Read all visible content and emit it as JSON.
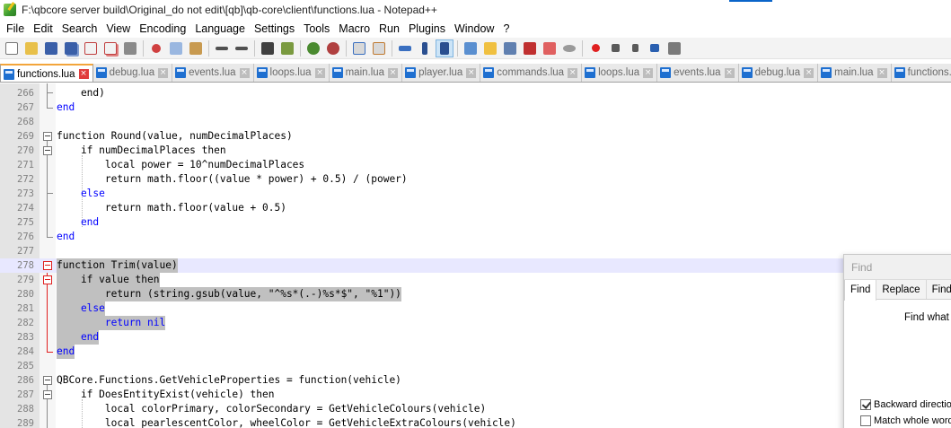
{
  "window": {
    "title": "F:\\qbcore server build\\Original_do not edit\\[qb]\\qb-core\\client\\functions.lua - Notepad++"
  },
  "menu": [
    "File",
    "Edit",
    "Search",
    "View",
    "Encoding",
    "Language",
    "Settings",
    "Tools",
    "Macro",
    "Run",
    "Plugins",
    "Window",
    "?"
  ],
  "toolbar_icons": [
    "new-file-icon",
    "open-file-icon",
    "save-icon",
    "save-all-icon",
    "close-icon",
    "close-all-icon",
    "print-icon",
    "cut-icon",
    "copy-icon",
    "paste-icon",
    "undo-icon",
    "redo-icon",
    "find-icon",
    "replace-icon",
    "zoom-in-icon",
    "zoom-out-icon",
    "sync-vertical-icon",
    "sync-horizontal-icon",
    "word-wrap-icon",
    "show-all-chars-icon",
    "indent-guide-icon",
    "lang-udl-icon",
    "doc-map-icon",
    "function-list-icon",
    "folder-workspace-icon",
    "monitoring-icon",
    "record-macro-icon",
    "stop-macro-icon",
    "play-macro-icon",
    "run-macro-multiple-icon",
    "save-macro-icon"
  ],
  "tabs": [
    {
      "label": "functions.lua",
      "active": true
    },
    {
      "label": "debug.lua"
    },
    {
      "label": "events.lua"
    },
    {
      "label": "loops.lua"
    },
    {
      "label": "main.lua"
    },
    {
      "label": "player.lua"
    },
    {
      "label": "commands.lua"
    },
    {
      "label": "loops.lua"
    },
    {
      "label": "events.lua"
    },
    {
      "label": "debug.lua"
    },
    {
      "label": "main.lua"
    },
    {
      "label": "functions.lua"
    }
  ],
  "editor": {
    "lines": [
      {
        "n": "266",
        "text": "    end)"
      },
      {
        "n": "267",
        "text": "end"
      },
      {
        "n": "268",
        "text": ""
      },
      {
        "n": "269",
        "text": "function Round(value, numDecimalPlaces)"
      },
      {
        "n": "270",
        "text": "    if numDecimalPlaces then"
      },
      {
        "n": "271",
        "text": "        local power = 10^numDecimalPlaces"
      },
      {
        "n": "272",
        "text": "        return math.floor((value * power) + 0.5) / (power)"
      },
      {
        "n": "273",
        "text": "    else"
      },
      {
        "n": "274",
        "text": "        return math.floor(value + 0.5)"
      },
      {
        "n": "275",
        "text": "    end"
      },
      {
        "n": "276",
        "text": "end"
      },
      {
        "n": "277",
        "text": ""
      },
      {
        "n": "278",
        "text": "function Trim(value)"
      },
      {
        "n": "279",
        "text": "    if value then"
      },
      {
        "n": "280",
        "text": "        return (string.gsub(value, \"^%s*(.-)%s*$\", \"%1\"))"
      },
      {
        "n": "281",
        "text": "    else"
      },
      {
        "n": "282",
        "text": "        return nil"
      },
      {
        "n": "283",
        "text": "    end"
      },
      {
        "n": "284",
        "text": "end"
      },
      {
        "n": "285",
        "text": ""
      },
      {
        "n": "286",
        "text": "QBCore.Functions.GetVehicleProperties = function(vehicle)"
      },
      {
        "n": "287",
        "text": "    if DoesEntityExist(vehicle) then"
      },
      {
        "n": "288",
        "text": "        local colorPrimary, colorSecondary = GetVehicleColours(vehicle)"
      },
      {
        "n": "289",
        "text": "        local pearlescentColor, wheelColor = GetVehicleExtraColours(vehicle)"
      }
    ]
  },
  "find_dialog": {
    "title": "Find",
    "tabs": [
      "Find",
      "Replace",
      "Find"
    ],
    "find_what_label": "Find what",
    "options": [
      {
        "label": "Backward direction",
        "checked": true
      },
      {
        "label": "Match whole word",
        "checked": false
      }
    ]
  },
  "colors": {
    "keyword": "#0000ff",
    "function": "#8000ff",
    "number": "#ff8000",
    "string": "#808080",
    "selection": "#c0c0c0",
    "caret_line": "#e8e8ff",
    "active_tab_accent": "#f3a53b"
  }
}
